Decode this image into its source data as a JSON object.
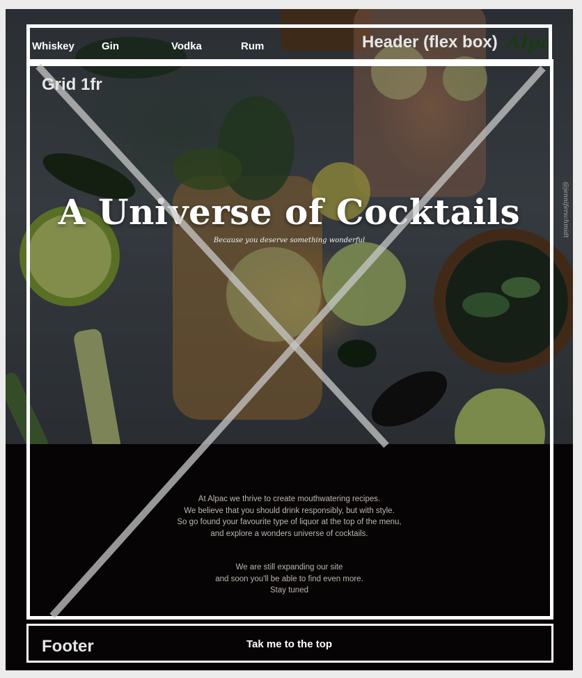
{
  "nav": {
    "items": [
      {
        "label": "Whiskey"
      },
      {
        "label": "Gin"
      },
      {
        "label": "Vodka"
      },
      {
        "label": "Rum"
      }
    ]
  },
  "logo": "Alpa",
  "hero": {
    "title": "A Universe of Cocktails",
    "subtitle": "Because you deserve something wonderful",
    "credit": "@jenniferschmidt"
  },
  "intro": {
    "lines": [
      "At Alpac we thrive to create mouthwatering recipes.",
      "We believe that you should drink responsibly, but with style.",
      "So go found your favourite type of liquor at the top of the menu,",
      "and explore a wonders universe of cocktails."
    ],
    "lines2": [
      "We are still expanding our site",
      "and soon you'll be able to find even more.",
      "Stay tuned"
    ]
  },
  "footer": {
    "link": "Tak me to the top"
  },
  "annotations": {
    "header_label": "Header (flex box)",
    "grid_label": "Grid 1fr",
    "footer_label": "Footer"
  }
}
